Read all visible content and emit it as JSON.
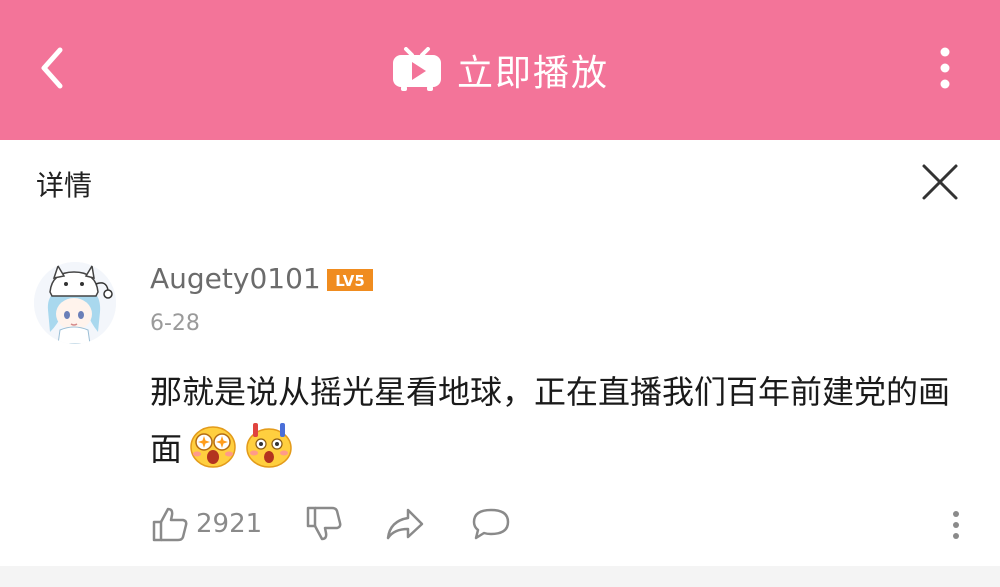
{
  "topbar": {
    "title": "立即播放",
    "accent_color": "#f37499",
    "back_icon": "chevron-left-icon",
    "title_icon": "tv-play-icon",
    "more_icon": "vertical-dots-icon"
  },
  "detail": {
    "label": "详情",
    "close_icon": "close-icon"
  },
  "comment": {
    "username": "Augety0101",
    "level": "LV5",
    "date": "6-28",
    "text": "那就是说从摇光星看地球，正在直播我们百年前建党的画面",
    "emojis": [
      "star-eyes-emoji-icon",
      "shocked-emoji-icon"
    ],
    "like_count": "2921",
    "actions": [
      "thumbs-up-icon",
      "thumbs-down-icon",
      "share-icon",
      "reply-icon",
      "more-icon"
    ]
  }
}
